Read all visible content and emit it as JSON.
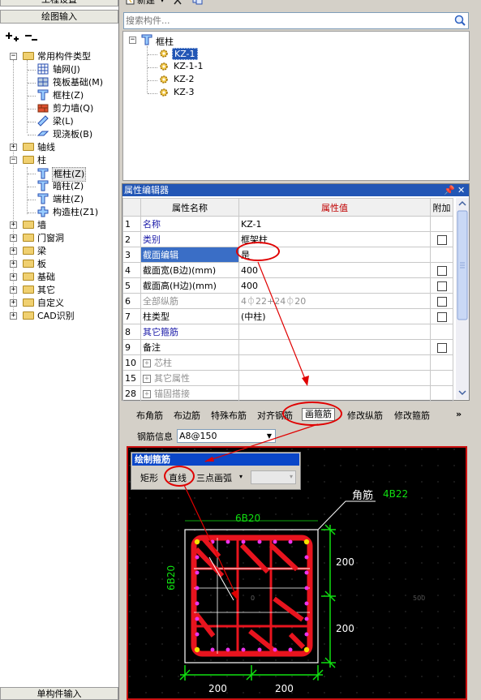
{
  "left_panel": {
    "top_header": "工程设置",
    "draw_input_header": "绘图输入",
    "bottom_header": "单构件输入",
    "tree": [
      {
        "label": "常用构件类型",
        "children": [
          "轴网(J)",
          "筏板基础(M)",
          "框柱(Z)",
          "剪力墙(Q)",
          "梁(L)",
          "现浇板(B)"
        ]
      },
      {
        "label": "轴线"
      },
      {
        "label": "柱",
        "children": [
          "框柱(Z)",
          "暗柱(Z)",
          "端柱(Z)",
          "构造柱(Z1)"
        ]
      },
      {
        "label": "墙"
      },
      {
        "label": "门窗洞"
      },
      {
        "label": "梁"
      },
      {
        "label": "板"
      },
      {
        "label": "基础"
      },
      {
        "label": "其它"
      },
      {
        "label": "自定义"
      },
      {
        "label": "CAD识别"
      }
    ]
  },
  "top_toolbar": {
    "new_label": "新建"
  },
  "search": {
    "placeholder": "搜索构件..."
  },
  "component_tree": {
    "root": "框柱",
    "items": [
      "KZ-1",
      "KZ-1-1",
      "KZ-2",
      "KZ-3"
    ],
    "selected": "KZ-1"
  },
  "property_editor": {
    "title": "属性编辑器",
    "headers": {
      "name": "属性名称",
      "value": "属性值",
      "add": "附加"
    },
    "rows": [
      {
        "no": "1",
        "name": "名称",
        "value": "KZ-1",
        "check": false
      },
      {
        "no": "2",
        "name": "类别",
        "value": "框架柱",
        "check": true
      },
      {
        "no": "3",
        "name": "截面编辑",
        "value": "是",
        "check": false
      },
      {
        "no": "4",
        "name": "截面宽(B边)(mm)",
        "value": "400",
        "check": true
      },
      {
        "no": "5",
        "name": "截面高(H边)(mm)",
        "value": "400",
        "check": true
      },
      {
        "no": "6",
        "name": "全部纵筋",
        "value": "4⏀22+24⏀20",
        "check": true
      },
      {
        "no": "7",
        "name": "柱类型",
        "value": "(中柱)",
        "check": true
      },
      {
        "no": "8",
        "name": "其它箍筋",
        "value": "",
        "check": false
      },
      {
        "no": "9",
        "name": "备注",
        "value": "",
        "check": true
      },
      {
        "no": "10",
        "name": "芯柱",
        "value": "",
        "check": false
      },
      {
        "no": "15",
        "name": "其它属性",
        "value": "",
        "check": false
      },
      {
        "no": "28",
        "name": "锚固搭接",
        "value": "",
        "check": false
      }
    ]
  },
  "stirrup_tabs": [
    "布角筋",
    "布边筋",
    "特殊布筋",
    "对齐钢筋",
    "画箍筋",
    "修改纵筋",
    "修改箍筋"
  ],
  "active_tab": "画箍筋",
  "rebar_info": {
    "label": "钢筋信息",
    "value": "A8@150"
  },
  "draw_dialog": {
    "title": "绘制箍筋",
    "buttons": [
      "矩形",
      "直线",
      "三点画弧"
    ]
  },
  "canvas": {
    "corner_label": "角筋",
    "corner_value": "4B22",
    "top_label": "6B20",
    "left_label": "6B20",
    "dim_right_1": "200",
    "dim_right_2": "200",
    "dim_bottom_1": "200",
    "dim_bottom_2": "200",
    "far_right": "500",
    "center_label": "0"
  },
  "colors": {
    "accent_blue": "#2256b5",
    "highlight_red": "#e00000",
    "rebar_red": "#e8141e",
    "dim_green": "#10e010"
  }
}
